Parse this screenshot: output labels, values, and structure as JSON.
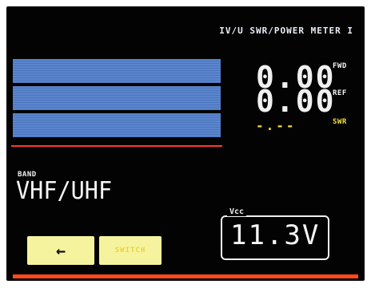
{
  "header": {
    "title": "IV/U SWR/POWER METER I"
  },
  "meter": {
    "bars": [
      {
        "name": "fwd",
        "level": 0
      },
      {
        "name": "ref",
        "level": 0
      },
      {
        "name": "swr",
        "level": 0
      }
    ],
    "fwd_value": "0.00",
    "fwd_unit": "FWD",
    "ref_value": "0.00",
    "ref_unit": "REF",
    "swr_value": "-.--",
    "swr_unit": "SWR"
  },
  "band": {
    "label": "BAND",
    "value": "VHF/UHF"
  },
  "buttons": {
    "back_label": "←",
    "switch_label": "SWITCH"
  },
  "vcc": {
    "label": "Vcc",
    "value": "11.3V"
  },
  "colors": {
    "screen_bg": "#030303",
    "bar_blue": "#5a84cb",
    "accent_red": "#ff3b1f",
    "swr_yellow": "#f2e03a",
    "button_yellow": "#f6f39e"
  },
  "icons": {
    "back": "arrow-left-icon"
  }
}
